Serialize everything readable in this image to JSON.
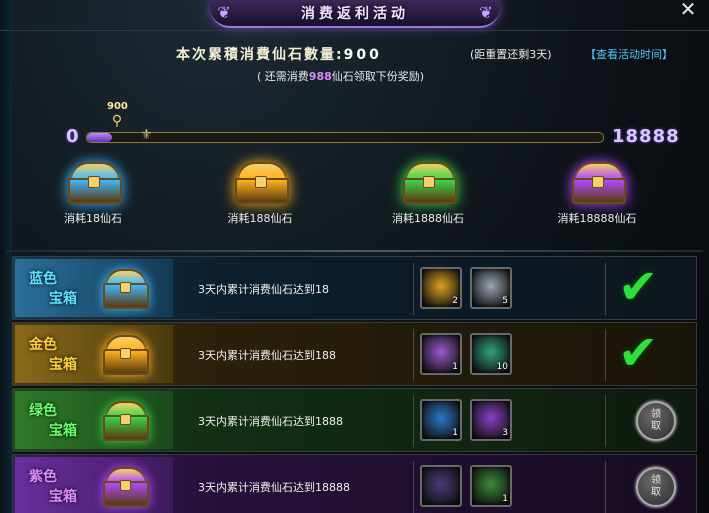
{
  "header": {
    "title": "消费返利活动",
    "close_glyph": "✕"
  },
  "summary": {
    "spent_label": "本次累積消費仙石數量:",
    "spent_value": "900",
    "reset_text": "(距重置还剩3天)",
    "time_link": "【查看活动时间】",
    "need_prefix": "( 还需消费",
    "need_amount": "988",
    "need_suffix": "仙石领取下份奖励)"
  },
  "progress": {
    "min_label": "0",
    "max_label": "18888",
    "current_label": "900",
    "current": 900,
    "max": 18888
  },
  "milestones": [
    {
      "label": "消耗18仙石",
      "color": "#3fb8ff"
    },
    {
      "label": "消耗188仙石",
      "color": "#ffb21e"
    },
    {
      "label": "消耗1888仙石",
      "color": "#39d84a"
    },
    {
      "label": "消耗18888仙石",
      "color": "#b04aff"
    }
  ],
  "rows": [
    {
      "name_line1": "蓝色",
      "name_line2": "宝箱",
      "name_color": "#5fe0ff",
      "chest_color": "#3fb8ff",
      "requirement": "3天内累计消费仙石达到18",
      "items": [
        {
          "icon": "golden-key-icon",
          "count": "2",
          "color": "#d9a21e"
        },
        {
          "icon": "silver-key-icon",
          "count": "5",
          "color": "#9aa6b2"
        }
      ],
      "status": "claimed",
      "claim_label_1": "",
      "claim_label_2": ""
    },
    {
      "name_line1": "金色",
      "name_line2": "宝箱",
      "name_color": "#ffd040",
      "chest_color": "#ffb21e",
      "requirement": "3天内累计消费仙石达到188",
      "items": [
        {
          "icon": "purple-scroll-icon",
          "count": "1",
          "color": "#9a5ad0"
        },
        {
          "icon": "green-potion-icon",
          "count": "10",
          "color": "#2fa07a"
        }
      ],
      "status": "claimed",
      "claim_label_1": "",
      "claim_label_2": ""
    },
    {
      "name_line1": "绿色",
      "name_line2": "宝箱",
      "name_color": "#6bff6b",
      "chest_color": "#39d84a",
      "requirement": "3天内累计消费仙石达到1888",
      "items": [
        {
          "icon": "blue-box-icon",
          "count": "1",
          "color": "#2a78c8"
        },
        {
          "icon": "purple-flower-icon",
          "count": "3",
          "color": "#8a3fc8"
        }
      ],
      "status": "unclaimed",
      "claim_label_1": "领",
      "claim_label_2": "取"
    },
    {
      "name_line1": "紫色",
      "name_line2": "宝箱",
      "name_color": "#e08aff",
      "chest_color": "#b04aff",
      "requirement": "3天内累计消费仙石达到18888",
      "items": [
        {
          "icon": "dark-creature-icon",
          "count": "",
          "color": "#4a3a7a"
        },
        {
          "icon": "red-fruit-icon",
          "count": "1",
          "color": "#3a8a3a"
        }
      ],
      "status": "unclaimed",
      "claim_label_1": "领",
      "claim_label_2": "取"
    }
  ]
}
